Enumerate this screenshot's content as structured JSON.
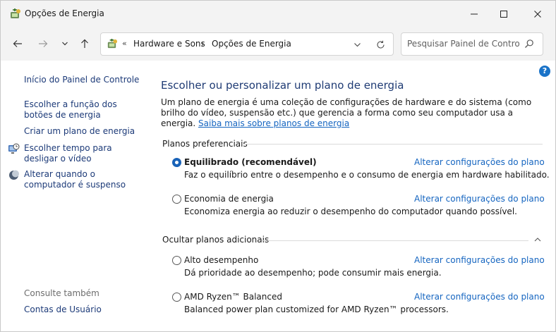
{
  "window": {
    "title": "Opções de Energia",
    "app_icon": "power-options-icon"
  },
  "toolbar": {
    "breadcrumb_prefix": "«",
    "breadcrumb": [
      "Hardware e Sons",
      "Opções de Energia"
    ],
    "breadcrumb_separator": "›",
    "search_placeholder": "Pesquisar Painel de Controle"
  },
  "sidebar": {
    "home": "Início do Painel de Controle",
    "items": [
      {
        "label": "Escolher a função dos botões de energia",
        "icon": null
      },
      {
        "label": "Criar um plano de energia",
        "icon": null
      },
      {
        "label": "Escolher tempo para desligar o vídeo",
        "icon": "monitor-clock-icon"
      },
      {
        "label": "Alterar quando o computador é suspenso",
        "icon": "moon-icon"
      }
    ],
    "see_also_title": "Consulte também",
    "see_also": [
      "Contas de Usuário"
    ]
  },
  "main": {
    "heading": "Escolher ou personalizar um plano de energia",
    "intro_text": "Um plano de energia é uma coleção de configurações de hardware e do sistema (como brilho do vídeo, suspensão etc.) que gerencia a forma como seu computador usa a energia. ",
    "intro_link": "Saiba mais sobre planos de energia",
    "preferred_heading": "Planos preferenciais",
    "additional_heading": "Ocultar planos adicionais",
    "change_link": "Alterar configurações do plano",
    "plans": [
      {
        "name": "Equilibrado (recomendável)",
        "desc": "Faz o equilíbrio entre o desempenho e o consumo de energia em hardware habilitado.",
        "selected": true
      },
      {
        "name": "Economia de energia",
        "desc": "Economiza energia ao reduzir o desempenho do computador quando possível.",
        "selected": false
      },
      {
        "name": "Alto desempenho",
        "desc": "Dá prioridade ao desempenho; pode consumir mais energia.",
        "selected": false
      },
      {
        "name": "AMD Ryzen™ Balanced",
        "desc": "Balanced power plan customized for AMD Ryzen™ processors.",
        "selected": false
      }
    ]
  },
  "colors": {
    "link": "#1565c0",
    "nav_link": "#1c3a78",
    "heading": "#1f3b74",
    "radio_selected": "#1a63b8",
    "help": "#1a73c8"
  }
}
